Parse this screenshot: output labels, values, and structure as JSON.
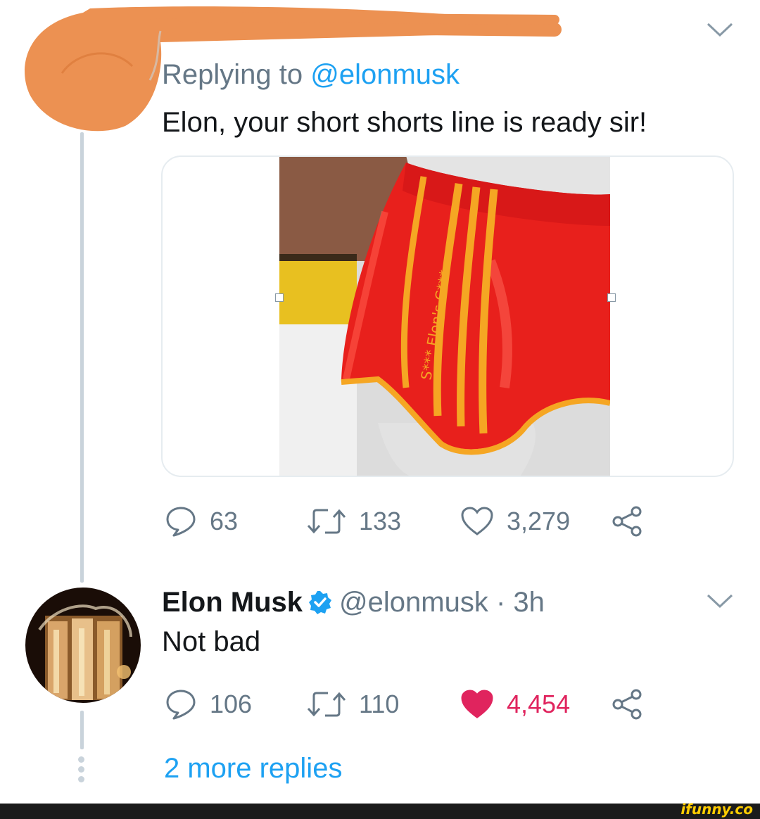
{
  "tweet1": {
    "replying_prefix": "Replying to",
    "replying_handle": "@elonmusk",
    "text": "Elon, your short shorts line is ready sir!",
    "image_text": "S*** Elon's C***",
    "stats": {
      "replies": "63",
      "retweets": "133",
      "likes": "3,279"
    }
  },
  "tweet2": {
    "name": "Elon Musk",
    "handle_time": "@elonmusk · 3h",
    "text": "Not bad",
    "stats": {
      "replies": "106",
      "retweets": "110",
      "likes": "4,454"
    }
  },
  "more_replies": "2 more replies",
  "watermark": "ifunny.co",
  "icons": {
    "reply": "speech-bubble-icon",
    "retweet": "retweet-icon",
    "like": "heart-icon",
    "share": "share-icon",
    "menu": "chevron-down-icon",
    "verified": "verified-badge-icon"
  },
  "colors": {
    "accent": "#1da1f2",
    "secondary_text": "#657786",
    "like_active": "#e0245e",
    "redaction": "#ec9152"
  }
}
